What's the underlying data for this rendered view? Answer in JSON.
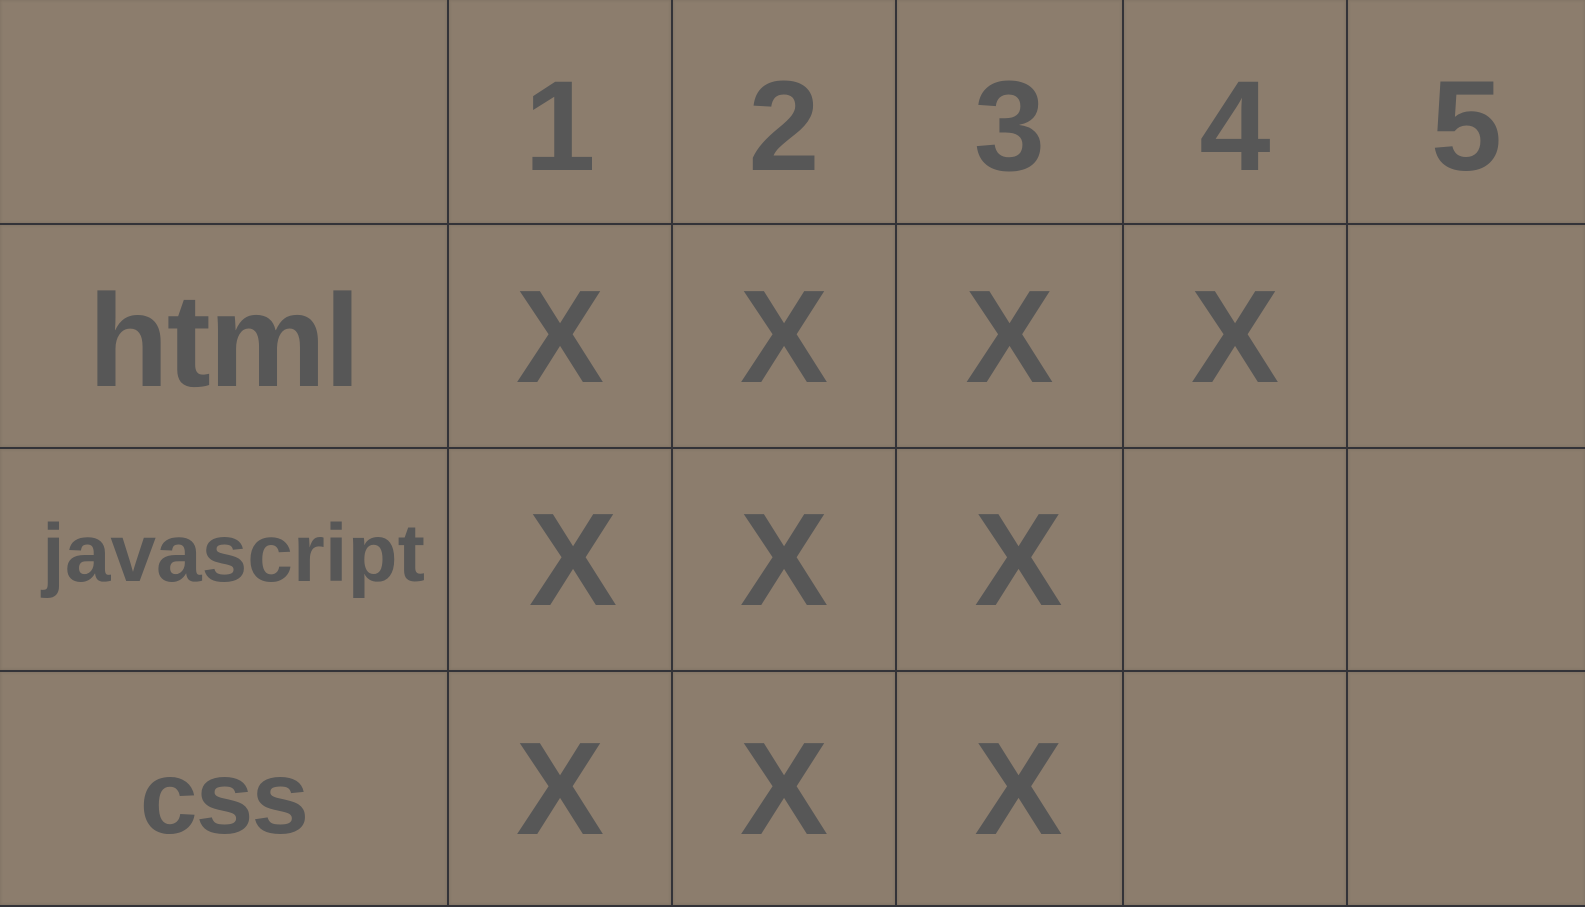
{
  "columns": [
    "1",
    "2",
    "3",
    "4",
    "5"
  ],
  "rows": [
    {
      "label": "html",
      "marks": [
        "X",
        "X",
        "X",
        "X",
        ""
      ]
    },
    {
      "label": "javascript",
      "marks": [
        "X",
        "X",
        "X",
        "",
        ""
      ]
    },
    {
      "label": "css",
      "marks": [
        "X",
        "X",
        "X",
        "",
        ""
      ]
    }
  ],
  "colors": {
    "background": "#8c7d6d",
    "text": "#575757",
    "grid_line": "#333338"
  }
}
